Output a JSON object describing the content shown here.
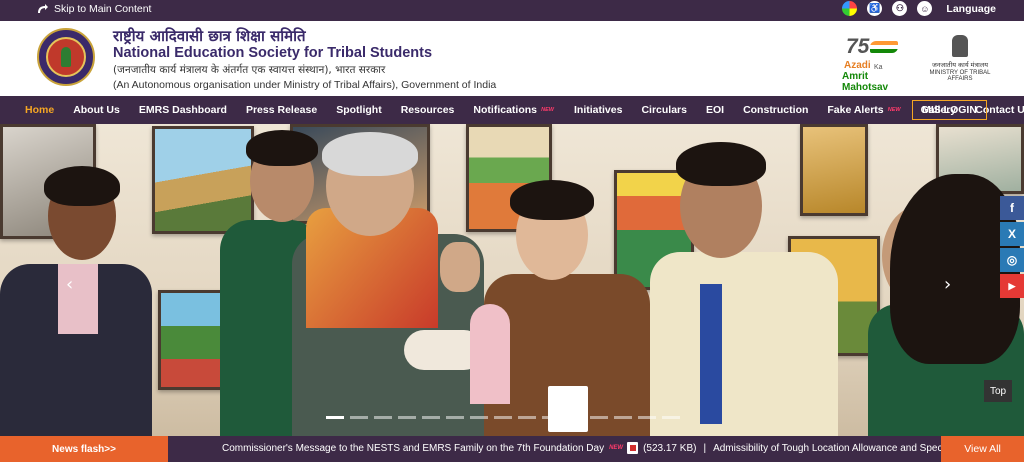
{
  "topbar": {
    "skip_label": "Skip to Main Content",
    "language_label": "Language"
  },
  "header": {
    "hindi_title": "राष्ट्रीय आदिवासी छात्र शिक्षा समिति",
    "english_title": "National Education Society for Tribal Students",
    "hindi_subtitle": "(जनजातीय कार्य मंत्रालय के अंतर्गत एक स्वायत्त संस्थान), भारत सरकार",
    "english_subtitle": "(An Autonomous organisation under Ministry of Tribal Affairs), Government of India",
    "azadi": {
      "number": "75",
      "line1": "Azadi",
      "line1b": "Ka",
      "line2": "Amrit Mahotsav"
    },
    "ministry": {
      "hindi": "जनजातीय कार्य मंत्रालय",
      "english": "MINISTRY OF TRIBAL AFFAIRS"
    }
  },
  "nav": {
    "items": [
      {
        "label": "Home",
        "active": true
      },
      {
        "label": "About Us"
      },
      {
        "label": "EMRS Dashboard"
      },
      {
        "label": "Press Release"
      },
      {
        "label": "Spotlight"
      },
      {
        "label": "Resources"
      },
      {
        "label": "Notifications",
        "badge": "NEW"
      },
      {
        "label": "Initiatives"
      },
      {
        "label": "Circulars"
      },
      {
        "label": "EOI"
      },
      {
        "label": "Construction"
      },
      {
        "label": "Fake Alerts",
        "badge": "NEW"
      },
      {
        "label": "Gallery"
      },
      {
        "label": "Contact Us"
      }
    ],
    "mis_login": "MIS LOGIN"
  },
  "hero": {
    "social": [
      {
        "icon": "facebook-icon",
        "glyph": "f",
        "color": "#3b5998"
      },
      {
        "icon": "x-twitter-icon",
        "glyph": "X",
        "color": "#2a7ab5"
      },
      {
        "icon": "instagram-icon",
        "glyph": "◎",
        "color": "#2a7ab5"
      },
      {
        "icon": "youtube-icon",
        "glyph": "▶",
        "color": "#e53935"
      }
    ],
    "top_label": "Top",
    "arrow_left": "‹",
    "arrow_right": "›"
  },
  "news": {
    "label": "News flash>>",
    "item1": "Commissioner's Message to the NESTS and EMRS Family on the 7th Foundation Day",
    "item1_badge": "NEW",
    "item1_size": "(523.17 KB)",
    "separator": "|",
    "item2": "Admissibility of Tough Location Allowance and Special Duty Allow",
    "view_all": "View All"
  },
  "colors": {
    "primary": "#3d2a47",
    "accent": "#f5a623",
    "orange": "#e8632c"
  }
}
